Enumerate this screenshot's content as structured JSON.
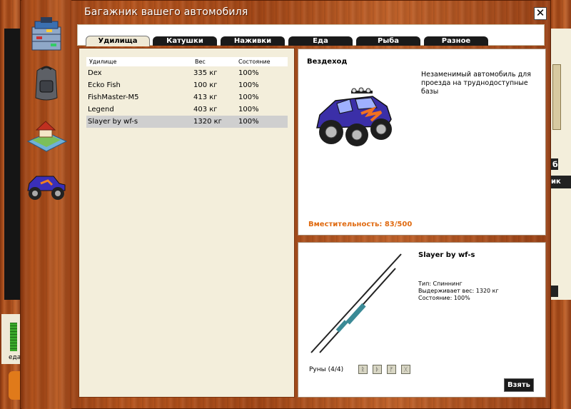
{
  "window": {
    "title": "Багажник вашего автомобиля",
    "close_label": "✕"
  },
  "tabs": [
    {
      "label": "Удилища",
      "active": true
    },
    {
      "label": "Катушки",
      "active": false
    },
    {
      "label": "Наживки",
      "active": false
    },
    {
      "label": "Еда",
      "active": false
    },
    {
      "label": "Рыба",
      "active": false
    },
    {
      "label": "Разное",
      "active": false
    }
  ],
  "list": {
    "headers": {
      "name": "Удилище",
      "weight": "Вес",
      "state": "Состояние"
    },
    "rows": [
      {
        "name": "Dex",
        "weight": "335 кг",
        "state": "100%"
      },
      {
        "name": "Ecko Fish",
        "weight": "100 кг",
        "state": "100%"
      },
      {
        "name": "FishMaster-M5",
        "weight": "413 кг",
        "state": "100%"
      },
      {
        "name": "Legend",
        "weight": "403 кг",
        "state": "100%"
      },
      {
        "name": "Slayer by wf-s",
        "weight": "1320 кг",
        "state": "100%",
        "selected": true
      }
    ]
  },
  "car": {
    "name": "Вездеход",
    "description": "Незаменимый автомобиль для проезда на труднодоступные базы",
    "capacity": "Вместительность: 83/500"
  },
  "item": {
    "name": "Slayer by wf-s",
    "type": "Тип: Спиннинг",
    "max_weight": "Выдерживает вес: 1320 кг",
    "condition": "Состояние: 100%",
    "runes_label": "Руны (4/4)",
    "take_label": "Взять"
  },
  "background": {
    "left_label": "еда",
    "right_label_1": "б",
    "right_label_2": "ик"
  },
  "colors": {
    "capacity_text": "#e06a10",
    "wood": "#b5541d",
    "list_bg": "#f3eedb",
    "tab_active_bg": "#efe9d5"
  },
  "icons": [
    "tackle-box-icon",
    "backpack-icon",
    "house-map-icon",
    "monster-truck-icon",
    "close-icon",
    "fishing-rod-icon",
    "rune-icon"
  ]
}
